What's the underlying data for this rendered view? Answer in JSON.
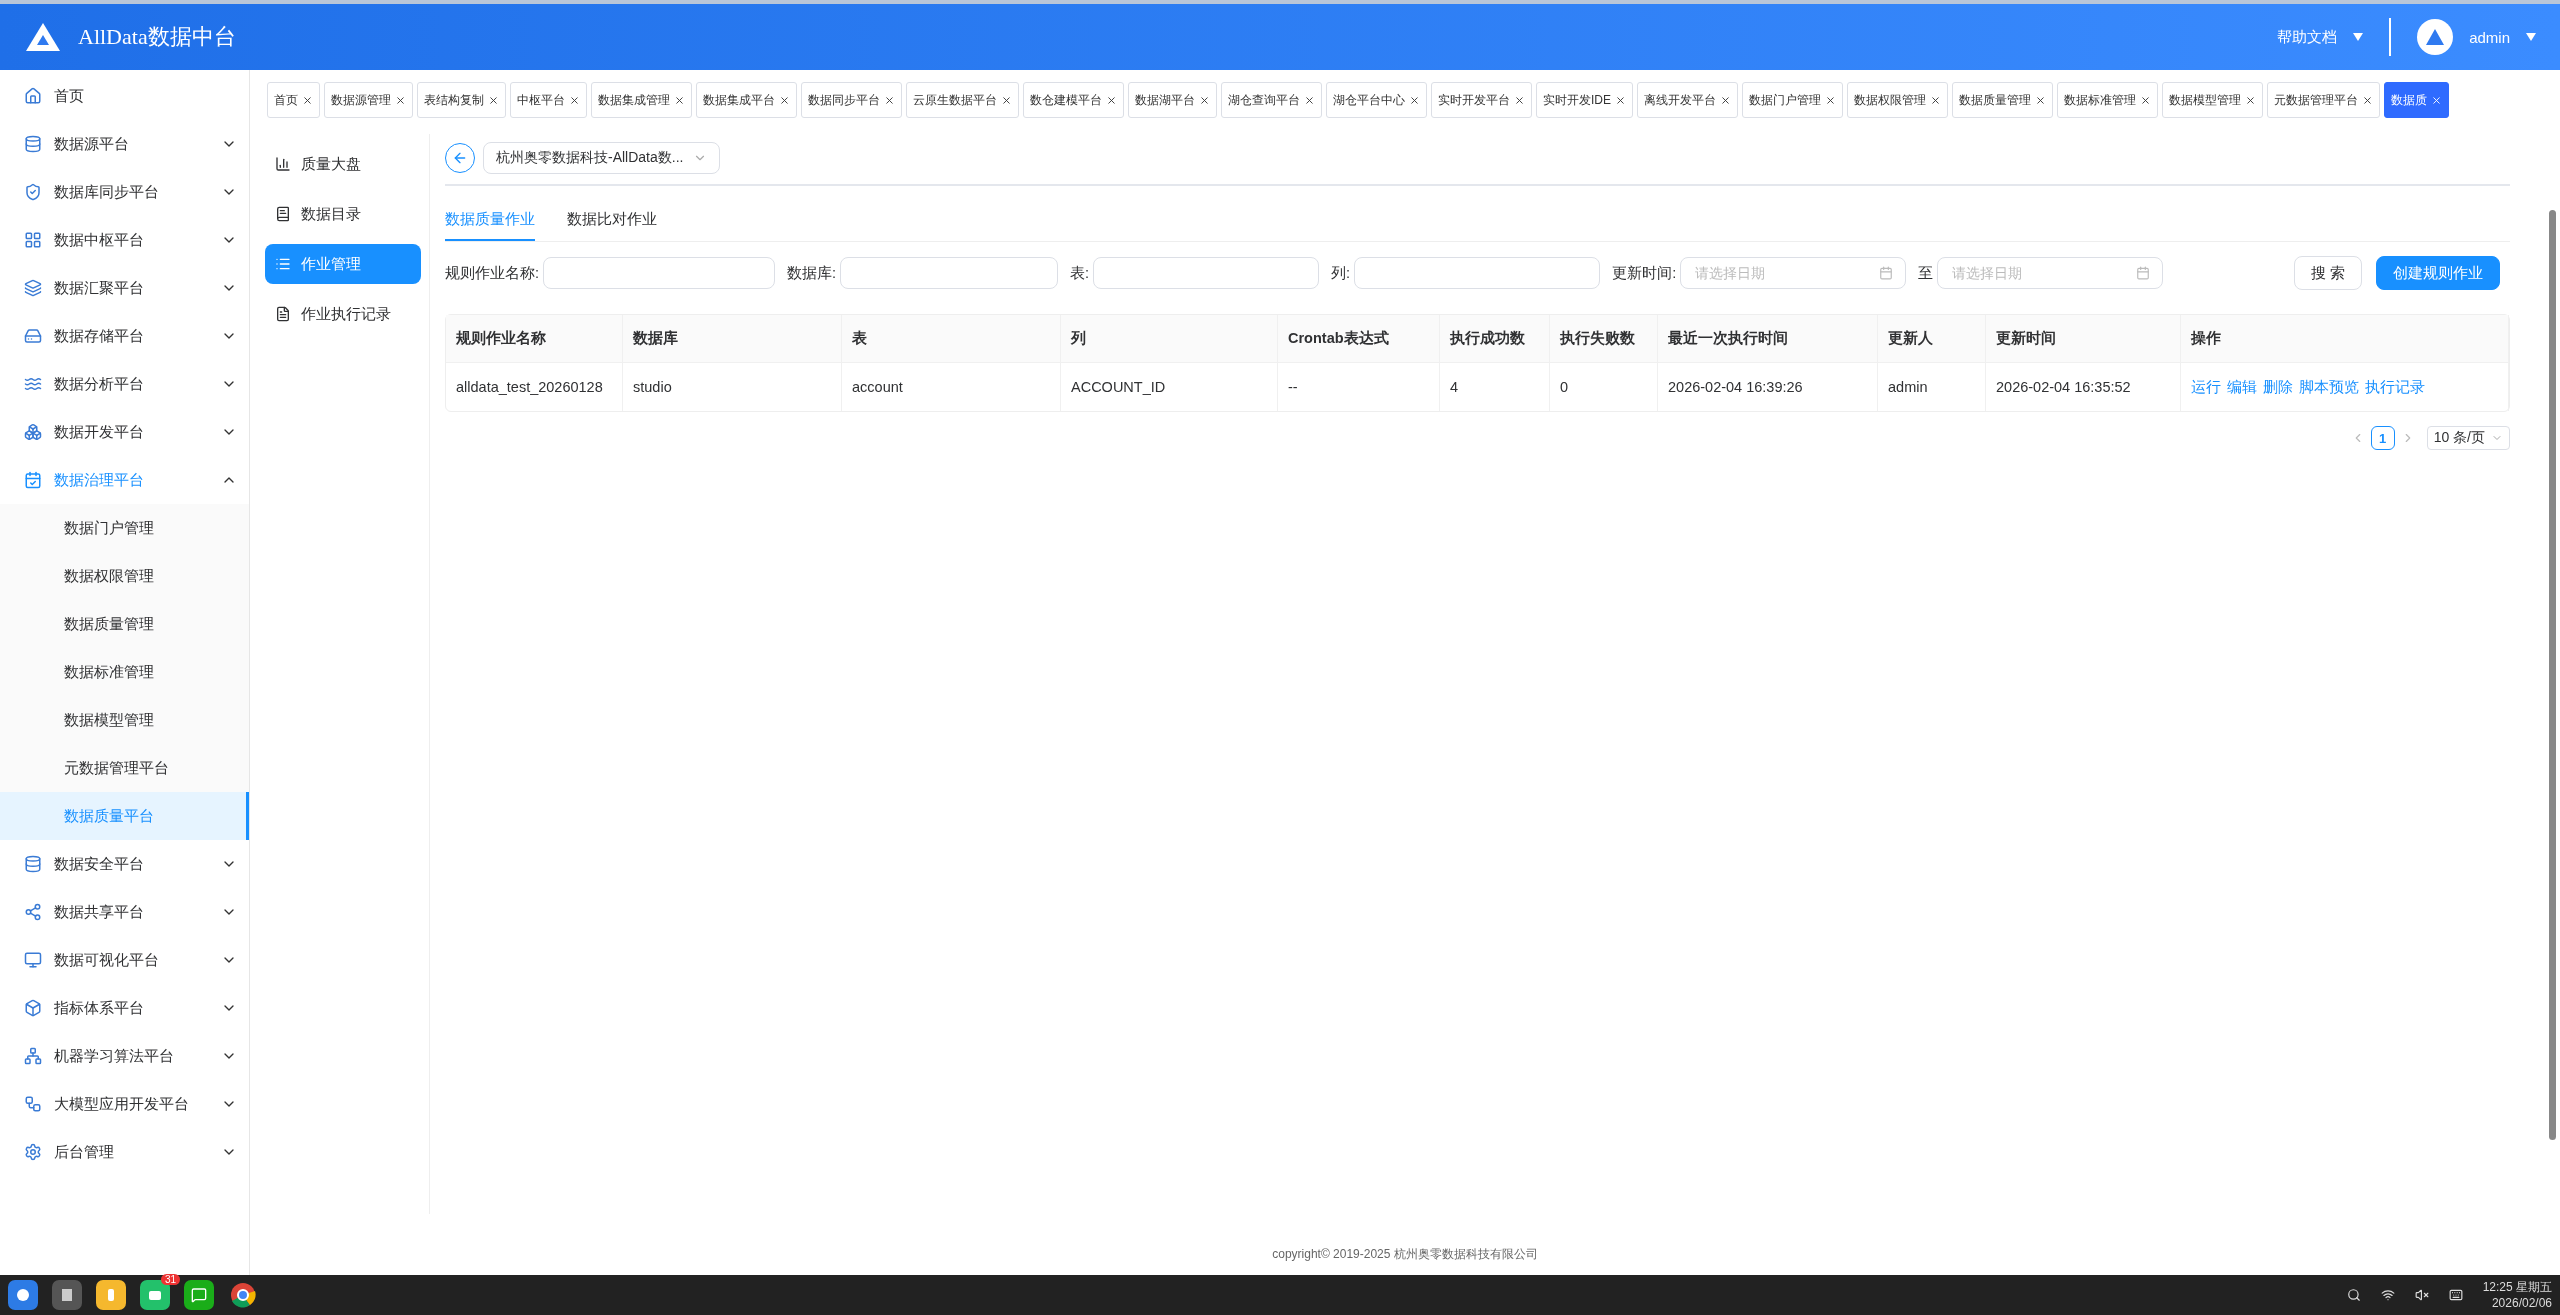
{
  "header": {
    "title": "AllData数据中台",
    "help_link": "帮助文档",
    "user": "admin"
  },
  "sidebar": {
    "items": [
      {
        "label": "首页",
        "kind": "link",
        "selected": false
      },
      {
        "label": "数据源平台",
        "kind": "group",
        "expanded": false,
        "selected": false
      },
      {
        "label": "数据库同步平台",
        "kind": "group",
        "expanded": false,
        "selected": false
      },
      {
        "label": "数据中枢平台",
        "kind": "group",
        "expanded": false,
        "selected": false
      },
      {
        "label": "数据汇聚平台",
        "kind": "group",
        "expanded": false,
        "selected": false
      },
      {
        "label": "数据存储平台",
        "kind": "group",
        "expanded": false,
        "selected": false
      },
      {
        "label": "数据分析平台",
        "kind": "group",
        "expanded": false,
        "selected": false
      },
      {
        "label": "数据开发平台",
        "kind": "group",
        "expanded": false,
        "selected": false
      },
      {
        "label": "数据治理平台",
        "kind": "group",
        "expanded": true,
        "selected": true,
        "children": [
          {
            "label": "数据门户管理",
            "selected": false
          },
          {
            "label": "数据权限管理",
            "selected": false
          },
          {
            "label": "数据质量管理",
            "selected": false
          },
          {
            "label": "数据标准管理",
            "selected": false
          },
          {
            "label": "数据模型管理",
            "selected": false
          },
          {
            "label": "元数据管理平台",
            "selected": false
          },
          {
            "label": "数据质量平台",
            "selected": true
          }
        ]
      },
      {
        "label": "数据安全平台",
        "kind": "group",
        "expanded": false,
        "selected": false
      },
      {
        "label": "数据共享平台",
        "kind": "group",
        "expanded": false,
        "selected": false
      },
      {
        "label": "数据可视化平台",
        "kind": "group",
        "expanded": false,
        "selected": false
      },
      {
        "label": "指标体系平台",
        "kind": "group",
        "expanded": false,
        "selected": false
      },
      {
        "label": "机器学习算法平台",
        "kind": "group",
        "expanded": false,
        "selected": false
      },
      {
        "label": "大模型应用开发平台",
        "kind": "group",
        "expanded": false,
        "selected": false
      },
      {
        "label": "后台管理",
        "kind": "group",
        "expanded": false,
        "selected": false
      }
    ]
  },
  "tabs": [
    {
      "label": "首页",
      "selected": false
    },
    {
      "label": "数据源管理",
      "selected": false
    },
    {
      "label": "表结构复制",
      "selected": false
    },
    {
      "label": "中枢平台",
      "selected": false
    },
    {
      "label": "数据集成管理",
      "selected": false
    },
    {
      "label": "数据集成平台",
      "selected": false
    },
    {
      "label": "数据同步平台",
      "selected": false
    },
    {
      "label": "云原生数据平台",
      "selected": false
    },
    {
      "label": "数仓建模平台",
      "selected": false
    },
    {
      "label": "数据湖平台",
      "selected": false
    },
    {
      "label": "湖仓查询平台",
      "selected": false
    },
    {
      "label": "湖仓平台中心",
      "selected": false
    },
    {
      "label": "实时开发平台",
      "selected": false
    },
    {
      "label": "实时开发IDE",
      "selected": false
    },
    {
      "label": "离线开发平台",
      "selected": false
    },
    {
      "label": "数据门户管理",
      "selected": false
    },
    {
      "label": "数据权限管理",
      "selected": false
    },
    {
      "label": "数据质量管理",
      "selected": false
    },
    {
      "label": "数据标准管理",
      "selected": false
    },
    {
      "label": "数据模型管理",
      "selected": false
    },
    {
      "label": "元数据管理平台",
      "selected": false
    },
    {
      "label": "数据质",
      "selected": true
    }
  ],
  "side_nav": [
    {
      "label": "质量大盘",
      "selected": false
    },
    {
      "label": "数据目录",
      "selected": false
    },
    {
      "label": "作业管理",
      "selected": true
    },
    {
      "label": "作业执行记录",
      "selected": false
    }
  ],
  "tenant_select": {
    "value": "杭州奥零数据科技-AllData数..."
  },
  "sub_tabs": [
    {
      "label": "数据质量作业",
      "selected": true
    },
    {
      "label": "数据比对作业",
      "selected": false
    }
  ],
  "filters": [
    {
      "kind": "text",
      "label": "规则作业名称:"
    },
    {
      "kind": "text",
      "label": "数据库:"
    },
    {
      "kind": "text",
      "label": "表:"
    },
    {
      "kind": "text",
      "label": "列:"
    },
    {
      "kind": "date",
      "label": "更新时间:",
      "placeholder": "请选择日期"
    },
    {
      "kind": "date",
      "label": "至",
      "placeholder": "请选择日期"
    }
  ],
  "buttons": [
    {
      "label": "搜 索",
      "kind": "default"
    },
    {
      "label": "创建规则作业",
      "kind": "primary"
    }
  ],
  "table": {
    "columns": [
      "规则作业名称",
      "数据库",
      "表",
      "列",
      "Crontab表达式",
      "执行成功数",
      "执行失败数",
      "最近一次执行时间",
      "更新人",
      "更新时间",
      "操作"
    ],
    "rows": [
      {
        "cells": [
          "alldata_test_20260128",
          "studio",
          "account",
          "ACCOUNT_ID",
          "--",
          "4",
          "0",
          "2026-02-04 16:39:26",
          "admin",
          "2026-02-04 16:35:52"
        ],
        "actions": [
          "运行",
          "编辑",
          "删除",
          "脚本预览",
          "执行记录"
        ]
      }
    ]
  },
  "pagination": {
    "pages": [
      {
        "label": "1",
        "selected": true
      }
    ],
    "page_size": "10 条/页"
  },
  "footer": "copyright© 2019-2025 杭州奥零数据科技有限公司",
  "taskbar": {
    "badge": "31",
    "time": "12:25 星期五",
    "date": "2026/02/06"
  }
}
